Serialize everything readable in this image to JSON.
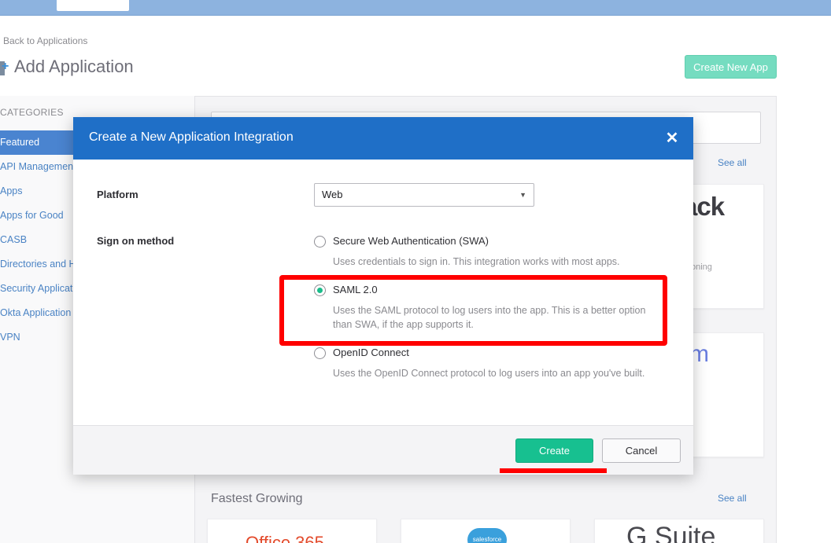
{
  "page": {
    "back_link": "Back to Applications",
    "title": "Add Application",
    "create_new_app": "Create New App",
    "categories_heading": "CATEGORIES",
    "categories": [
      "Featured",
      "API Management",
      "Apps",
      "Apps for Good",
      "CASB",
      "Directories and H",
      "Security Applicat",
      "Okta Application",
      "VPN"
    ],
    "see_all": "See all",
    "card_brand_1": "ack",
    "card_small_text": "oning",
    "card_brand_2": "m",
    "section_fastest": "Fastest Growing",
    "brand_office": "Office 365",
    "brand_salesforce": "salesforce",
    "brand_gsuite": "G Suite"
  },
  "modal": {
    "title": "Create a New Application Integration",
    "close_glyph": "✕",
    "platform_label": "Platform",
    "platform_value": "Web",
    "sign_on_label": "Sign on method",
    "options": [
      {
        "label": "Secure Web Authentication (SWA)",
        "description": "Uses credentials to sign in. This integration works with most apps.",
        "checked": false
      },
      {
        "label": "SAML 2.0",
        "description": "Uses the SAML protocol to log users into the app. This is a better option than SWA, if the app supports it.",
        "checked": true
      },
      {
        "label": "OpenID Connect",
        "description": "Uses the OpenID Connect protocol to log users into an app you've built.",
        "checked": false
      }
    ],
    "create_button": "Create",
    "cancel_button": "Cancel"
  },
  "colors": {
    "header": "#1f6fc7",
    "primary_button": "#17c090",
    "annotation": "#ff0000"
  }
}
